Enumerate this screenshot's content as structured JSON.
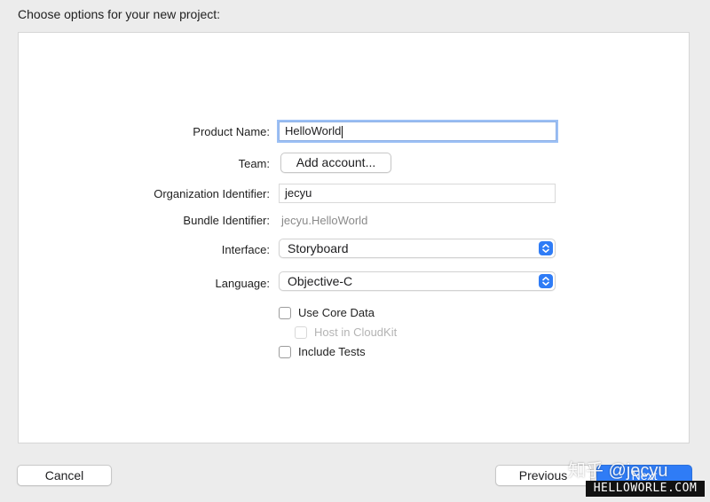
{
  "header": {
    "title": "Choose options for your new project:"
  },
  "form": {
    "product_name": {
      "label": "Product Name:",
      "value": "HelloWorld"
    },
    "team": {
      "label": "Team:",
      "button_label": "Add account..."
    },
    "organization_identifier": {
      "label": "Organization Identifier:",
      "value": "jecyu"
    },
    "bundle_identifier": {
      "label": "Bundle Identifier:",
      "value": "jecyu.HelloWorld"
    },
    "interface": {
      "label": "Interface:",
      "selected": "Storyboard"
    },
    "language": {
      "label": "Language:",
      "selected": "Objective-C"
    },
    "checkboxes": {
      "use_core_data": {
        "label": "Use Core Data",
        "checked": false
      },
      "host_in_cloudkit": {
        "label": "Host in CloudKit",
        "checked": false,
        "enabled": false
      },
      "include_tests": {
        "label": "Include Tests",
        "checked": false
      }
    }
  },
  "footer": {
    "cancel_label": "Cancel",
    "previous_label": "Previous",
    "next_label": "Next"
  },
  "watermark": {
    "site": "知乎 @jecyu",
    "badge": "HELLOWORLE.COM"
  },
  "colors": {
    "accent": "#2f7cf6",
    "focus_ring": "#9cc0f5",
    "panel_bg": "#ffffff",
    "window_bg": "#ececec"
  }
}
